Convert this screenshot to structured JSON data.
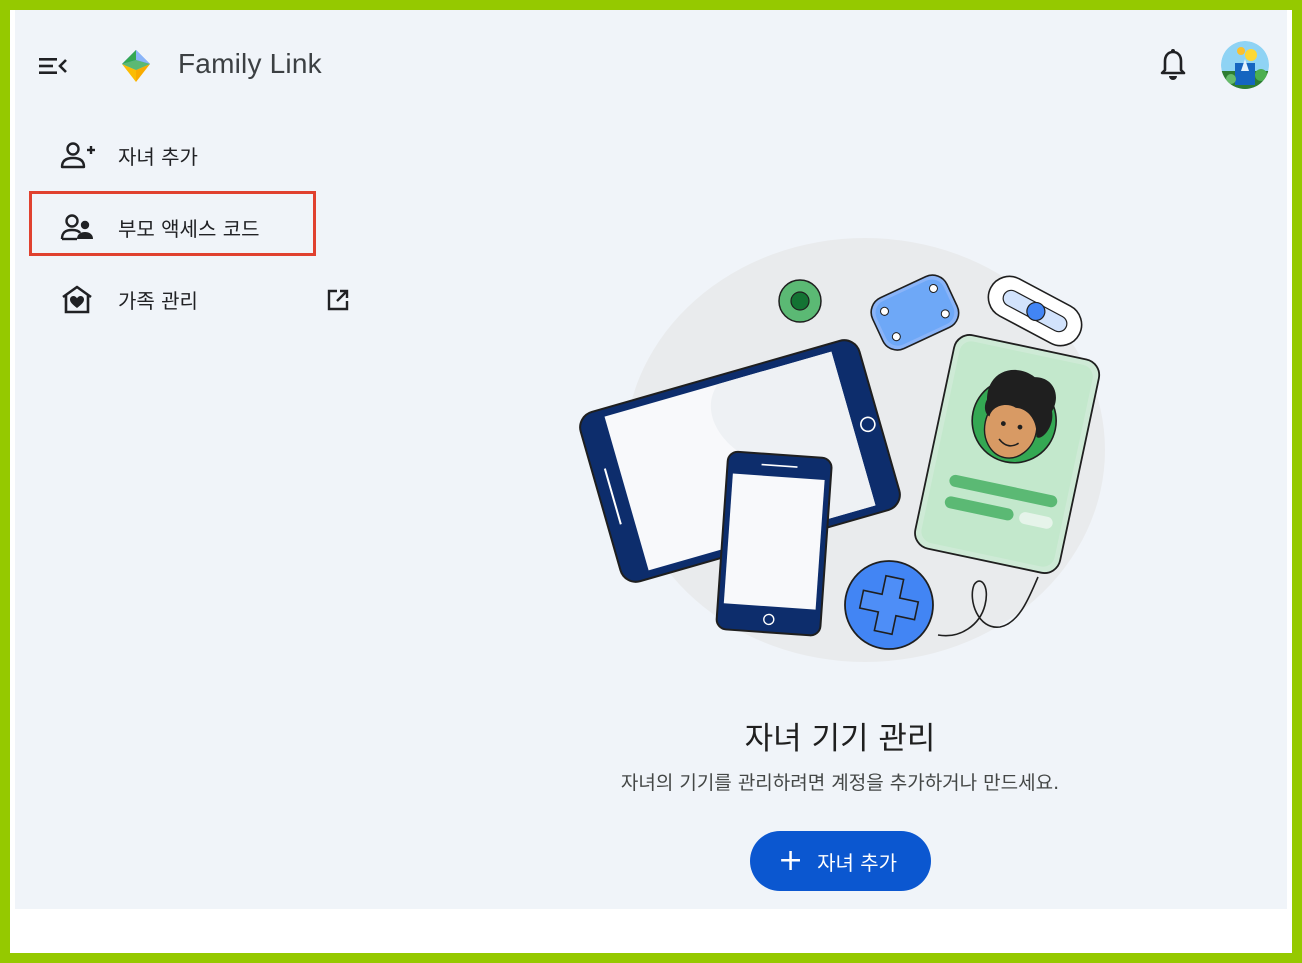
{
  "header": {
    "app_title": "Family Link",
    "icons": {
      "menu": "menu-collapse-icon",
      "logo": "family-link-logo",
      "bell": "notifications-bell-icon",
      "avatar": "account-avatar"
    }
  },
  "sidebar": {
    "items": [
      {
        "label": "자녀 추가",
        "icon": "person-add-icon"
      },
      {
        "label": "부모 액세스 코드",
        "icon": "supervisor-account-icon",
        "highlighted": true
      },
      {
        "label": "가족 관리",
        "icon": "home-heart-icon",
        "trailing_icon": "open-in-new-icon"
      }
    ]
  },
  "main": {
    "title": "자녀 기기 관리",
    "subtitle": "자녀의 기기를 관리하려면 계정을 추가하거나 만드세요.",
    "button": {
      "icon": "+",
      "label": "자녀 추가"
    }
  },
  "colors": {
    "frame_border": "#95c900",
    "background": "#f0f4f9",
    "primary": "#0b57d0",
    "highlight_border": "#e0412f"
  }
}
